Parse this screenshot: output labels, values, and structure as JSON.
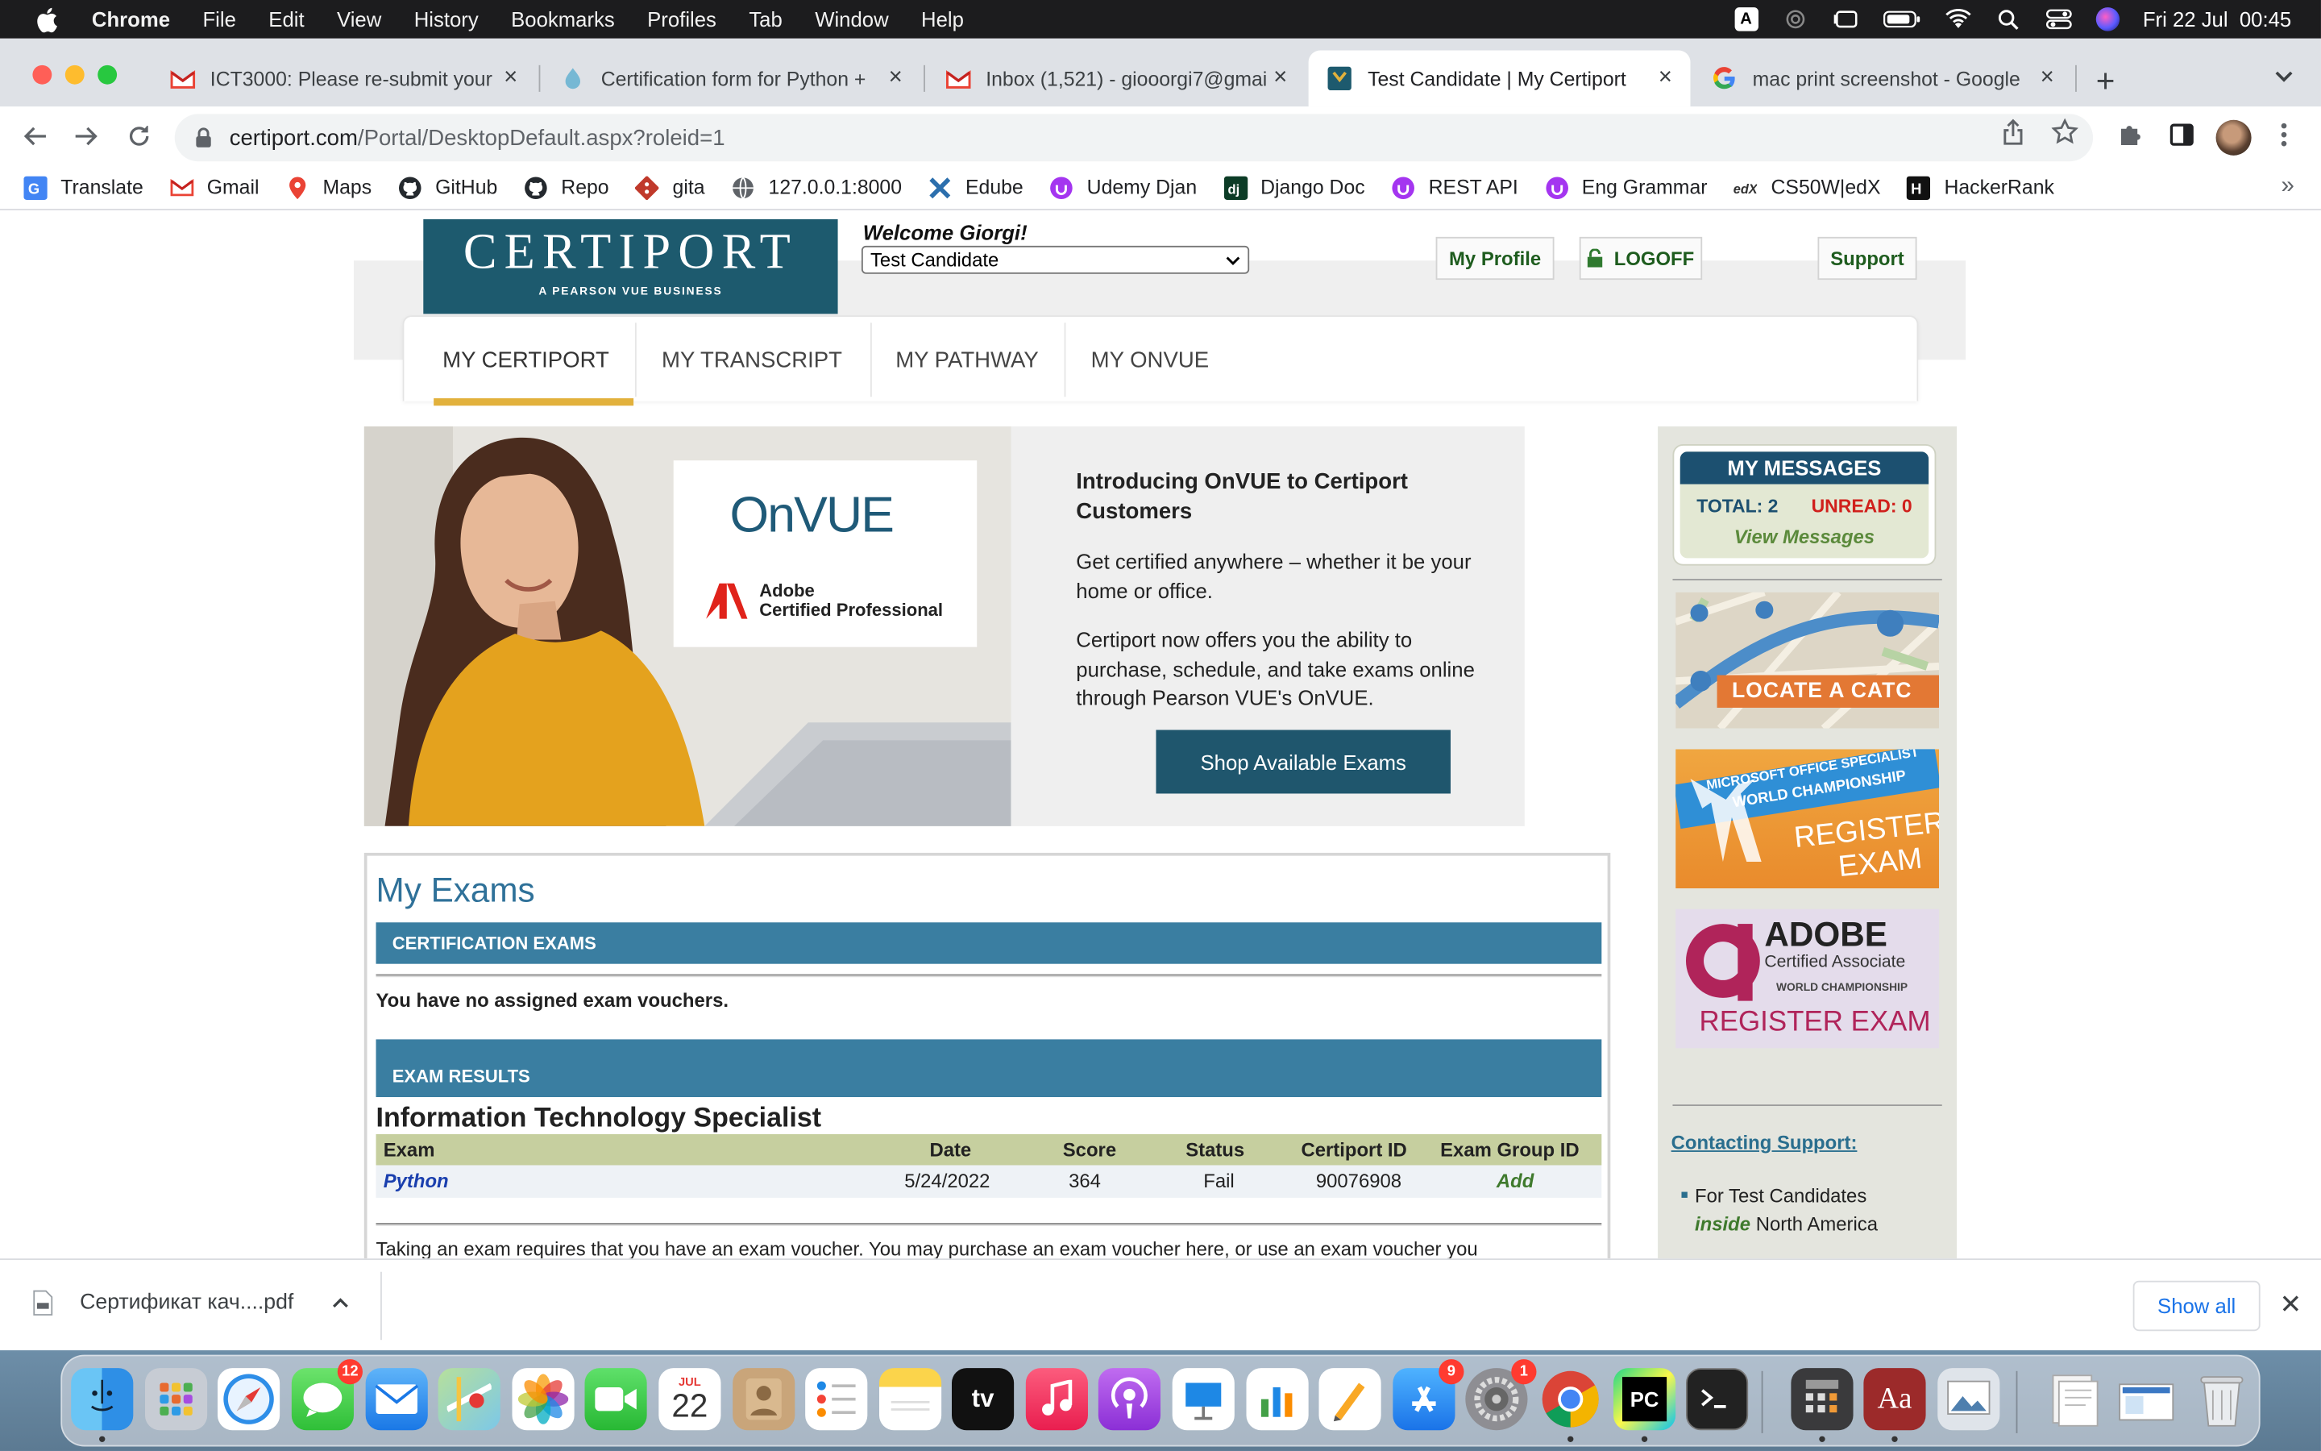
{
  "menubar": {
    "app": "Chrome",
    "items": [
      "File",
      "Edit",
      "View",
      "History",
      "Bookmarks",
      "Profiles",
      "Tab",
      "Window",
      "Help"
    ],
    "input_source": "A",
    "clock": "Fri 22 Jul  00:45"
  },
  "tabs": [
    {
      "title": "ICT3000: Please re-submit your",
      "icon": "gmail-icon"
    },
    {
      "title": "Certification form for Python +",
      "icon": "form-icon"
    },
    {
      "title": "Inbox (1,521) - giooorgi7@gmail",
      "icon": "gmail-icon"
    },
    {
      "title": "Test Candidate | My Certiport",
      "icon": "certiport-icon"
    },
    {
      "title": "mac print screenshot - Google",
      "icon": "google-icon"
    }
  ],
  "address": {
    "host": "certiport.com",
    "path": "/Portal/DesktopDefault.aspx?roleid=1"
  },
  "bookmarks": [
    {
      "label": "Translate",
      "icon": "translate-icon"
    },
    {
      "label": "Gmail",
      "icon": "gmail-icon"
    },
    {
      "label": "Maps",
      "icon": "maps-icon"
    },
    {
      "label": "GitHub",
      "icon": "github-icon"
    },
    {
      "label": "Repo",
      "icon": "github-icon"
    },
    {
      "label": "gita",
      "icon": "git-icon"
    },
    {
      "label": "127.0.0.1:8000",
      "icon": "globe-icon"
    },
    {
      "label": "Edube",
      "icon": "edube-icon"
    },
    {
      "label": "Udemy Djan",
      "icon": "udemy-icon"
    },
    {
      "label": "Django Doc",
      "icon": "django-icon"
    },
    {
      "label": "REST API",
      "icon": "udemy-icon"
    },
    {
      "label": "Eng Grammar",
      "icon": "udemy-icon"
    },
    {
      "label": "CS50W|edX",
      "icon": "edx-icon"
    },
    {
      "label": "HackerRank",
      "icon": "hackerrank-icon"
    }
  ],
  "header": {
    "logo": "CERTIPORT",
    "logo_sub": "A PEARSON VUE BUSINESS",
    "welcome": "Welcome Giorgi!",
    "role": "Test Candidate",
    "my_profile": "My Profile",
    "logoff": "LOGOFF",
    "support": "Support"
  },
  "nav": [
    "MY CERTIPORT",
    "MY TRANSCRIPT",
    "MY PATHWAY",
    "MY ONVUE"
  ],
  "hero": {
    "onvue": "OnVUE",
    "adobe_line1": "Adobe",
    "adobe_line2": "Certified Professional",
    "title": "Introducing OnVUE to Certiport Customers",
    "p1": "Get certified anywhere – whether it be your home or office.",
    "p2": "Certiport now offers you the ability to purchase, schedule, and take exams online through Pearson VUE's OnVUE.",
    "button": "Shop Available Exams"
  },
  "messages": {
    "title": "MY MESSAGES",
    "total": "TOTAL: 2",
    "unread": "UNREAD: 0",
    "view": "View Messages"
  },
  "promos": {
    "catc": "LOCATE A CATC",
    "mos_line1": "MICROSOFT OFFICE SPECIALIST",
    "mos_line2": "WORLD CHAMPIONSHIP",
    "mos_reg1": "REGISTER",
    "mos_reg2": "EXAM",
    "adobe_title": "ADOBE",
    "adobe_sub": "Certified Associate",
    "adobe_wc": "WORLD CHAMPIONSHIP",
    "adobe_reg": "REGISTER EXAM"
  },
  "support": {
    "heading": "Contacting Support:",
    "line1": "For Test Candidates",
    "inside": "inside",
    "region": "North America"
  },
  "exams": {
    "heading": "My Exams",
    "cert_bar": "CERTIFICATION EXAMS",
    "no_vouchers": "You have no assigned exam vouchers.",
    "results_bar": "EXAM RESULTS",
    "group_title": "Information Technology Specialist",
    "columns": [
      "Exam",
      "Date",
      "Score",
      "Status",
      "Certiport ID",
      "Exam Group ID"
    ],
    "rows": [
      {
        "exam": "Python",
        "date": "5/24/2022",
        "score": "364",
        "status": "Fail",
        "id": "90076908",
        "group": "Add"
      }
    ],
    "voucher_text": "Taking an exam requires that you have an exam voucher. You may purchase an exam voucher here, or use an exam voucher you"
  },
  "downloads": {
    "file": "Сертификат кач....pdf",
    "show_all": "Show all"
  },
  "dock": {
    "calendar_month": "JUL",
    "calendar_day": "22",
    "tv": "tv",
    "messages_badge": "12",
    "appstore_badge": "9",
    "settings_badge": "1",
    "pycharm": "PC",
    "dictionary": "Aa"
  }
}
